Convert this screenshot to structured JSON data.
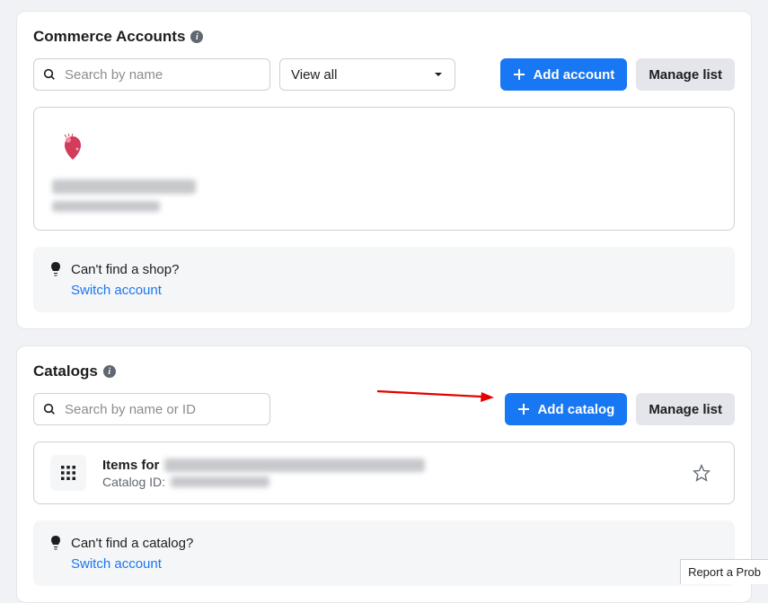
{
  "commerce": {
    "title": "Commerce Accounts",
    "search_placeholder": "Search by name",
    "filter_selected": "View all",
    "add_button": "Add account",
    "manage_button": "Manage list",
    "help": {
      "title": "Can't find a shop?",
      "link": "Switch account"
    }
  },
  "catalogs": {
    "title": "Catalogs",
    "search_placeholder": "Search by name or ID",
    "add_button": "Add catalog",
    "manage_button": "Manage list",
    "item": {
      "prefix": "Items for",
      "id_label": "Catalog ID:"
    },
    "help": {
      "title": "Can't find a catalog?",
      "link": "Switch account"
    }
  },
  "footer": {
    "report": "Report a Prob"
  }
}
